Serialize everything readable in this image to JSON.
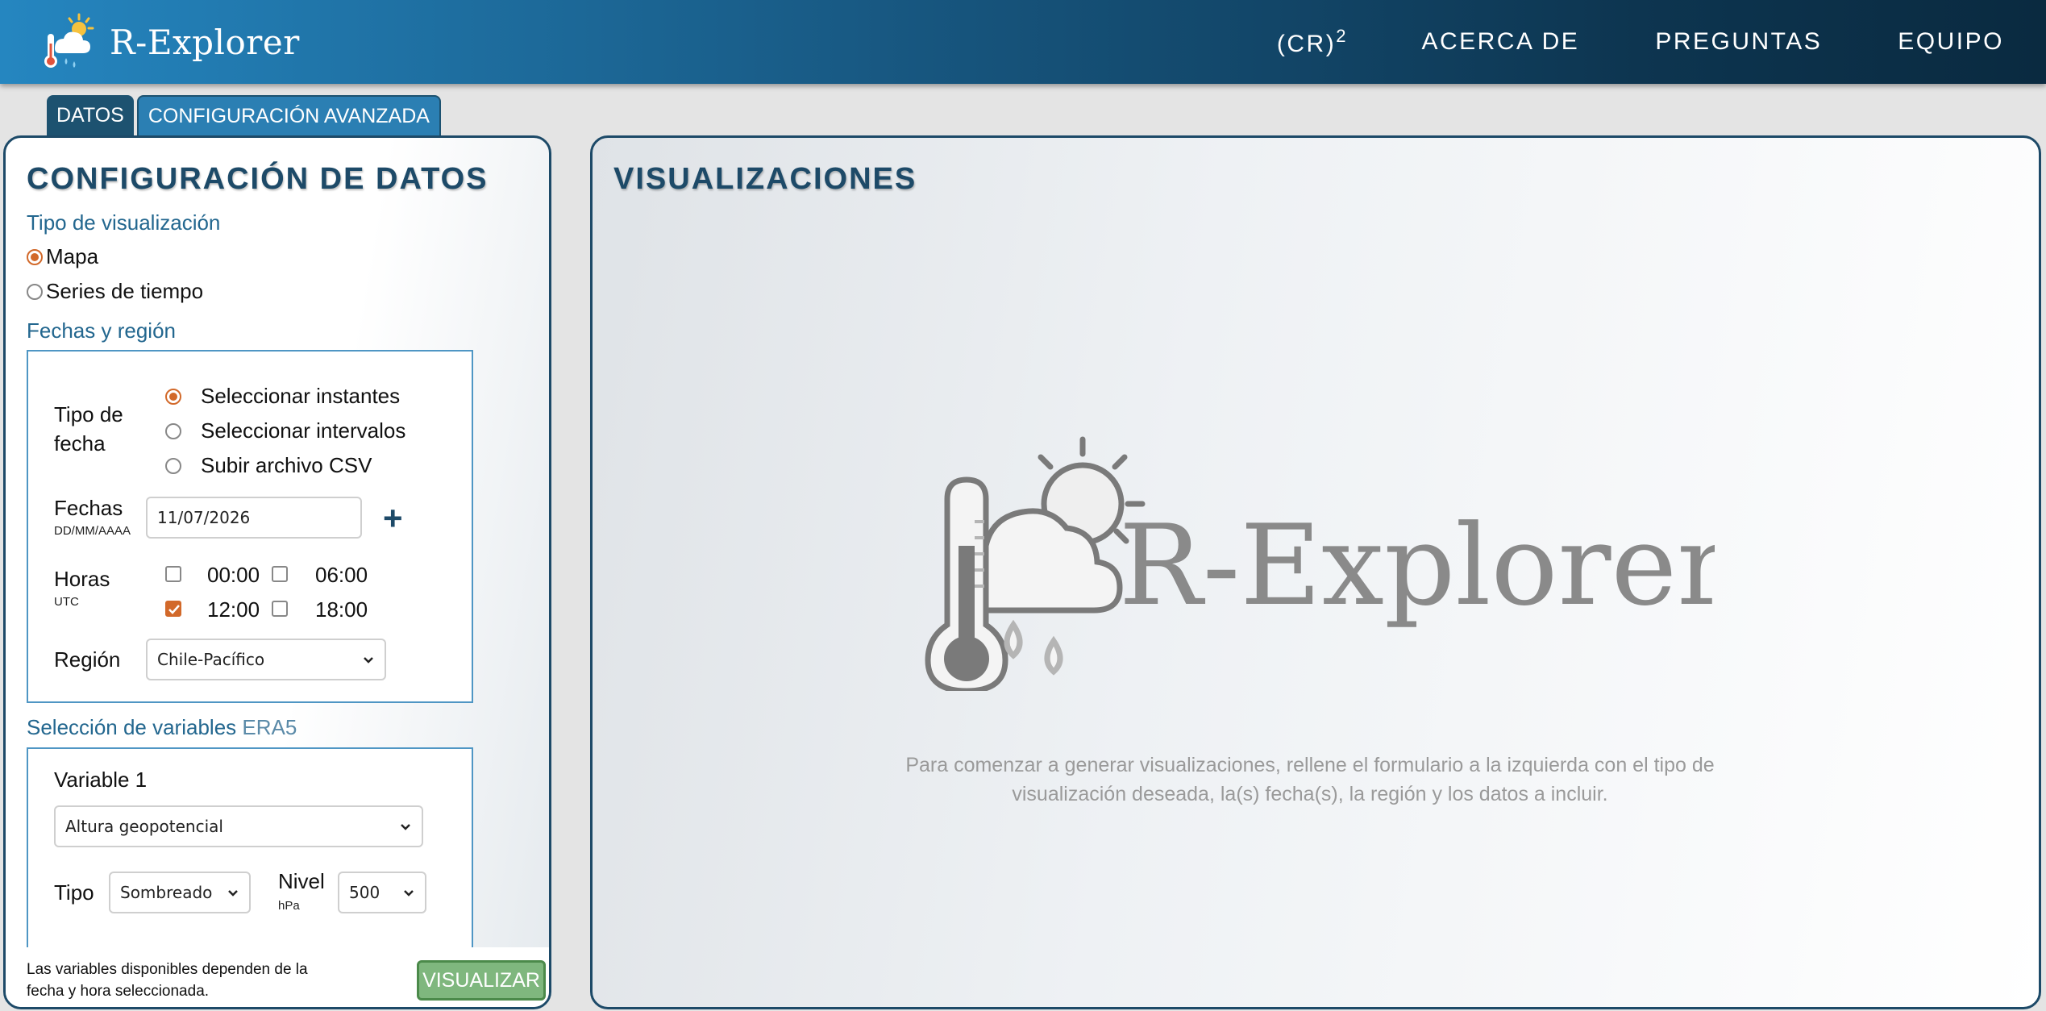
{
  "header": {
    "brand": "R-Explorer",
    "nav": [
      {
        "label": "(CR)",
        "sup": "2"
      },
      {
        "label": "ACERCA DE"
      },
      {
        "label": "PREGUNTAS"
      },
      {
        "label": "EQUIPO"
      }
    ]
  },
  "tabs": [
    {
      "label": "DATOS",
      "active": true
    },
    {
      "label": "CONFIGURACIÓN AVANZADA",
      "active": false
    }
  ],
  "config": {
    "title": "CONFIGURACIÓN DE DATOS",
    "viz_type_label": "Tipo de visualización",
    "viz_types": [
      {
        "label": "Mapa",
        "selected": true
      },
      {
        "label": "Series de tiempo",
        "selected": false
      }
    ],
    "dates_section_label": "Fechas y región",
    "date_type_label": "Tipo de fecha",
    "date_types": [
      {
        "label": "Seleccionar instantes",
        "selected": true
      },
      {
        "label": "Seleccionar intervalos",
        "selected": false
      },
      {
        "label": "Subir archivo CSV",
        "selected": false
      }
    ],
    "dates_label": "Fechas",
    "dates_format": "DD/MM/AAAA",
    "date_value": "11/07/2026",
    "hours_label": "Horas",
    "hours_unit": "UTC",
    "hours": [
      {
        "label": "00:00",
        "checked": false
      },
      {
        "label": "06:00",
        "checked": false
      },
      {
        "label": "12:00",
        "checked": true
      },
      {
        "label": "18:00",
        "checked": false
      }
    ],
    "region_label": "Región",
    "region_value": "Chile-Pacífico",
    "variables_label": "Selección de variables",
    "variables_source": "ERA5",
    "variable1_label": "Variable 1",
    "variable1_value": "Altura geopotencial",
    "tipo_label": "Tipo",
    "tipo_value": "Sombreado",
    "nivel_label": "Nivel",
    "nivel_unit": "hPa",
    "nivel_value": "500",
    "footer_note": "Las variables disponibles dependen de la fecha y hora seleccionada.",
    "submit_label": "VISUALIZAR"
  },
  "visualizations": {
    "title": "VISUALIZACIONES",
    "logo_text": "R-Explorer",
    "hint": "Para comenzar a generar visualizaciones, rellene el formulario a la izquierda con el tipo de visualización deseada, la(s) fecha(s), la región y los datos a incluir."
  },
  "colors": {
    "accent": "#1d4a68",
    "link": "#23678f",
    "radio_checked": "#d2692a",
    "submit": "#7fb77e"
  }
}
